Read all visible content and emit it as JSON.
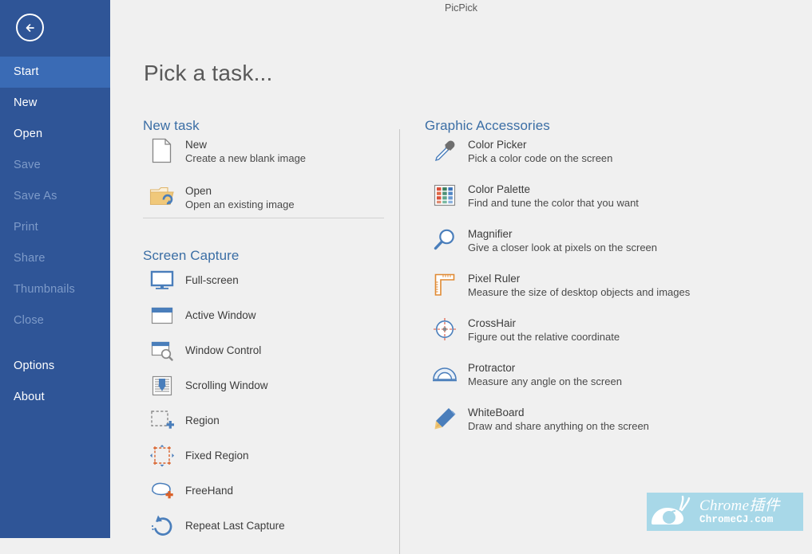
{
  "app": {
    "title": "PicPick"
  },
  "sidebar": {
    "back_icon": "back-arrow-icon",
    "items": [
      {
        "label": "Start",
        "state": "active"
      },
      {
        "label": "New",
        "state": "enabled"
      },
      {
        "label": "Open",
        "state": "enabled"
      },
      {
        "label": "Save",
        "state": "disabled"
      },
      {
        "label": "Save As",
        "state": "disabled"
      },
      {
        "label": "Print",
        "state": "disabled"
      },
      {
        "label": "Share",
        "state": "disabled"
      },
      {
        "label": "Thumbnails",
        "state": "disabled"
      },
      {
        "label": "Close",
        "state": "disabled"
      },
      {
        "label": "Options",
        "state": "enabled"
      },
      {
        "label": "About",
        "state": "enabled"
      }
    ]
  },
  "main": {
    "page_title": "Pick a task...",
    "sections": [
      {
        "heading": "New task",
        "items": [
          {
            "icon": "new-document-icon",
            "title": "New",
            "desc": "Create a new blank image"
          },
          {
            "icon": "open-folder-icon",
            "title": "Open",
            "desc": "Open an existing image"
          }
        ]
      },
      {
        "heading": "Screen Capture",
        "items": [
          {
            "icon": "monitor-icon",
            "title": "Full-screen",
            "desc": ""
          },
          {
            "icon": "active-window-icon",
            "title": "Active Window",
            "desc": ""
          },
          {
            "icon": "window-control-icon",
            "title": "Window Control",
            "desc": ""
          },
          {
            "icon": "scrolling-window-icon",
            "title": "Scrolling Window",
            "desc": ""
          },
          {
            "icon": "region-icon",
            "title": "Region",
            "desc": ""
          },
          {
            "icon": "fixed-region-icon",
            "title": "Fixed Region",
            "desc": ""
          },
          {
            "icon": "freehand-icon",
            "title": "FreeHand",
            "desc": ""
          },
          {
            "icon": "repeat-capture-icon",
            "title": "Repeat Last Capture",
            "desc": ""
          }
        ]
      },
      {
        "heading": "Graphic Accessories",
        "items": [
          {
            "icon": "eyedropper-icon",
            "title": "Color Picker",
            "desc": "Pick a color code on the screen"
          },
          {
            "icon": "color-palette-icon",
            "title": "Color Palette",
            "desc": "Find and tune the color that you want"
          },
          {
            "icon": "magnifier-icon",
            "title": "Magnifier",
            "desc": "Give a closer look at pixels on the screen"
          },
          {
            "icon": "pixel-ruler-icon",
            "title": "Pixel Ruler",
            "desc": "Measure the size of desktop objects and images"
          },
          {
            "icon": "crosshair-icon",
            "title": "CrossHair",
            "desc": "Figure out the relative coordinate"
          },
          {
            "icon": "protractor-icon",
            "title": "Protractor",
            "desc": "Measure any angle on the screen"
          },
          {
            "icon": "whiteboard-icon",
            "title": "WhiteBoard",
            "desc": "Draw and share anything on the screen"
          }
        ]
      }
    ]
  },
  "watermark": {
    "line1": "Chrome插件",
    "line2": "ChromeCJ.com",
    "icon": "snail-logo-icon"
  },
  "colors": {
    "sidebar": "#2f5597",
    "sidebar_active": "#3a6bb5",
    "sidebar_disabled_text": "#7e9bc9",
    "background": "#f0f0f0",
    "heading": "#3b6ea5",
    "accent_blue": "#4a7ebb",
    "accent_orange": "#d9622b",
    "watermark_bg": "#a8d8e8"
  }
}
